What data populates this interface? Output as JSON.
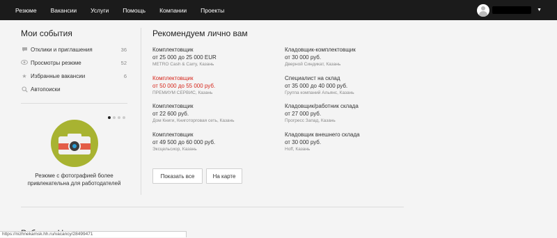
{
  "nav": {
    "items": [
      "Резюме",
      "Вакансии",
      "Услуги",
      "Помощь",
      "Компании",
      "Проекты"
    ]
  },
  "my_events": {
    "title": "Мои события",
    "items": [
      {
        "label": "Отклики и приглашения",
        "count": "36",
        "icon": "chat-icon"
      },
      {
        "label": "Просмотры резюме",
        "count": "52",
        "icon": "eye-icon"
      },
      {
        "label": "Избранные вакансии",
        "count": "6",
        "icon": "star-icon"
      },
      {
        "label": "Автопоиски",
        "count": "",
        "icon": "search-icon"
      }
    ]
  },
  "promo": {
    "text": "Резюме с фотографией более привлекательна для работодателей",
    "slides_total": 4,
    "active_slide": 1
  },
  "recommend": {
    "title": "Рекомендуем лично вам",
    "left": [
      {
        "title": "Комплектовщик",
        "salary": "от 25 000 до 25 000 EUR",
        "company": "METRO Cash & Carry, Казань",
        "highlight": false
      },
      {
        "title": "Комплектовщик",
        "salary": "от 50 000 до 55 000 руб.",
        "company": "ПРЕМИУМ СЕРВИС, Казань",
        "highlight": true
      },
      {
        "title": "Комплектовщик",
        "salary": "от 22 600 руб.",
        "company": "Дом Книги, Книготорговая сеть, Казань",
        "highlight": false
      },
      {
        "title": "Комплектовщик",
        "salary": "от 49 500 до 60 000 руб.",
        "company": "Эксцельсиор, Казань",
        "highlight": false
      }
    ],
    "right": [
      {
        "title": "Кладовщик-комплектовщик",
        "salary": "от 30 000 руб.",
        "company": "Дверной Синдикат, Казань",
        "highlight": false
      },
      {
        "title": "Специалист на склад",
        "salary": "от 35 000 до 40 000 руб.",
        "company": "Группа компаний Альянс, Казань",
        "highlight": false
      },
      {
        "title": "Кладовщик/работник склада",
        "salary": "от 27 000 руб.",
        "company": "Прогресс Запад, Казань",
        "highlight": false
      },
      {
        "title": "Кладовщик внешнего склада",
        "salary": "от 30 000 руб.",
        "company": "Hoff, Казань",
        "highlight": false
      }
    ],
    "show_all": "Показать все",
    "on_map": "На карте"
  },
  "bottom_title": "Работа в Нижнекамске",
  "status_url": "https://nizhnekamsk.hh.ru/vacancy/28499471",
  "colors": {
    "topbar": "#1b1b1b",
    "highlight": "#d6261b",
    "promo_circle": "#a8b331"
  }
}
